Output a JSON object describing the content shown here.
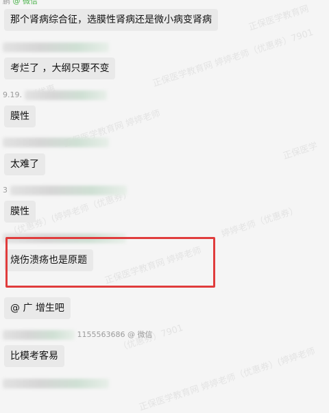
{
  "messages": [
    {
      "meta_text": "@ 微信",
      "meta_prefix": "鹏",
      "text": "那个肾病综合征，选膜性肾病还是微小病变肾病"
    },
    {
      "meta_text": "",
      "meta_prefix": "",
      "text": "考烂了 ，大纲只要不变"
    },
    {
      "meta_text": "",
      "meta_prefix": "9.19.",
      "text": "膜性"
    },
    {
      "meta_text": "",
      "meta_prefix": "",
      "text": "太难了"
    },
    {
      "meta_text": "",
      "meta_prefix": "3",
      "text": "膜性"
    },
    {
      "meta_text": "",
      "meta_prefix": "",
      "text": "烧伤溃疡也是原题"
    },
    {
      "meta_text": "",
      "meta_prefix": "",
      "text": "@    广 增生吧"
    },
    {
      "meta_text": "1155563686 @ 微信",
      "meta_prefix": "",
      "text": "比模考客易"
    }
  ],
  "watermarks": [
    "正保医学教育网",
    "正保医学教育网 婷婷老师（优惠券）7901",
    "（优惠",
    "正保医学教育网 婷婷老师",
    "正保医学",
    "（优惠券）(婷婷老师（优惠券）",
    "婷婷老师（优惠券）",
    "正保医学教育网 婷婷老师",
    "（优惠券）7901",
    "正保医学教育网 婷婷老师（优惠券）(婷婷老师"
  ],
  "colors": {
    "highlight": "#e03c3c",
    "wechat_green": "#4bb34b",
    "bubble": "#e9e9e9"
  }
}
